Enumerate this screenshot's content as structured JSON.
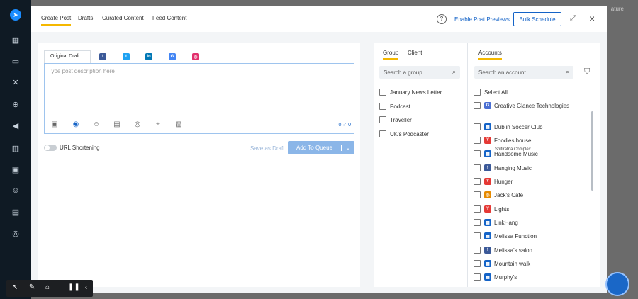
{
  "background": {
    "right_text": "ature"
  },
  "sidebar": {
    "items": [
      "send-icon",
      "dashboard-icon",
      "messages-icon",
      "tools-icon",
      "target-icon",
      "megaphone-icon",
      "analytics-icon",
      "media-icon",
      "team-icon",
      "report-icon",
      "support-icon"
    ]
  },
  "header": {
    "tabs": [
      "Create Post",
      "Drafts",
      "Curated Content",
      "Feed Content"
    ],
    "help_label": "?",
    "preview_link": "Enable Post Previews",
    "bulk_button": "Bulk Schedule",
    "close_label": "×"
  },
  "editor": {
    "original_tab": "Original Draft",
    "networks": [
      {
        "name": "facebook",
        "label": "f",
        "color": "#3b5998"
      },
      {
        "name": "twitter",
        "label": "t",
        "color": "#1da1f2"
      },
      {
        "name": "linkedin",
        "label": "in",
        "color": "#0077b5"
      },
      {
        "name": "google-business",
        "label": "G",
        "color": "#4285f4"
      },
      {
        "name": "instagram",
        "label": "◎",
        "color": "#e1306c"
      }
    ],
    "placeholder": "Type post description here",
    "counter": "0 ✓ 0",
    "url_shortening": "URL Shortening",
    "save_draft": "Save as Draft",
    "add_queue": "Add To Queue"
  },
  "groups": {
    "tabs": [
      "Group",
      "Client"
    ],
    "search_placeholder": "Search a group",
    "items": [
      "January News Letter",
      "Podcast",
      "Traveller",
      "UK's Podcaster"
    ]
  },
  "accounts": {
    "tab": "Accounts",
    "search_placeholder": "Search an account",
    "select_all": "Select All",
    "items": [
      {
        "name": "Creative Glance Technologies",
        "sub": "Shitiratna Complex...",
        "color": "#4a6fd3",
        "glyph": "G"
      },
      {
        "name": "Dublin Soccer Club",
        "color": "#1463c7",
        "glyph": "▦"
      },
      {
        "name": "Foodies house",
        "color": "#e53935",
        "glyph": "Y"
      },
      {
        "name": "Handsome Music",
        "color": "#1463c7",
        "glyph": "▦"
      },
      {
        "name": "Hanging Music",
        "color": "#3b5998",
        "glyph": "f"
      },
      {
        "name": "Hunger",
        "color": "#e53935",
        "glyph": "Y"
      },
      {
        "name": "Jack's Cafe",
        "color": "#e68a00",
        "glyph": "◎"
      },
      {
        "name": "Lights",
        "color": "#e53935",
        "glyph": "Y"
      },
      {
        "name": "LinkHang",
        "color": "#1463c7",
        "glyph": "▦"
      },
      {
        "name": "Melissa Function",
        "color": "#1463c7",
        "glyph": "▦"
      },
      {
        "name": "Melissa's salon",
        "color": "#3b5998",
        "glyph": "f"
      },
      {
        "name": "Mountain walk",
        "color": "#1463c7",
        "glyph": "▦"
      },
      {
        "name": "Murphy's",
        "color": "#1463c7",
        "glyph": "▦"
      }
    ]
  }
}
